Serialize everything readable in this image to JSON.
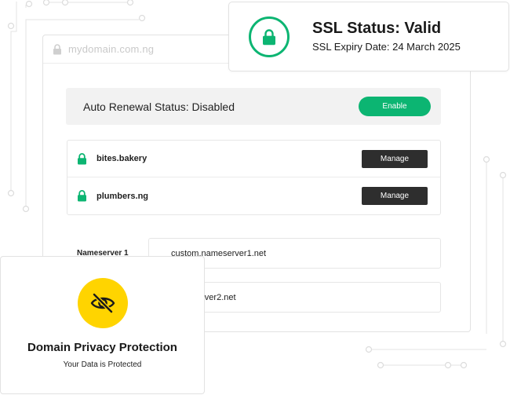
{
  "address_bar": {
    "url": "mydomain.com.ng",
    "icon": "lock-icon"
  },
  "renewal": {
    "label": "Auto Renewal Status: Disabled",
    "button": "Enable"
  },
  "domains": [
    {
      "name": "bites.bakery",
      "button": "Manage",
      "icon": "lock-icon"
    },
    {
      "name": "plumbers.ng",
      "button": "Manage",
      "icon": "lock-icon"
    }
  ],
  "nameservers": {
    "label": "Nameserver 1",
    "values": [
      "custom.nameserver1.net",
      "nameserver2.net"
    ]
  },
  "ssl": {
    "title": "SSL Status: Valid",
    "expiry": "SSL Expiry Date: 24 March 2025",
    "icon": "lock-icon"
  },
  "privacy": {
    "title": "Domain Privacy Protection",
    "subtitle": "Your Data is Protected",
    "icon": "eye-slash-icon"
  },
  "colors": {
    "green": "#0cb572",
    "yellow": "#ffd400",
    "dark_button": "#2e2e2e",
    "muted_bg": "#f2f2f2"
  }
}
